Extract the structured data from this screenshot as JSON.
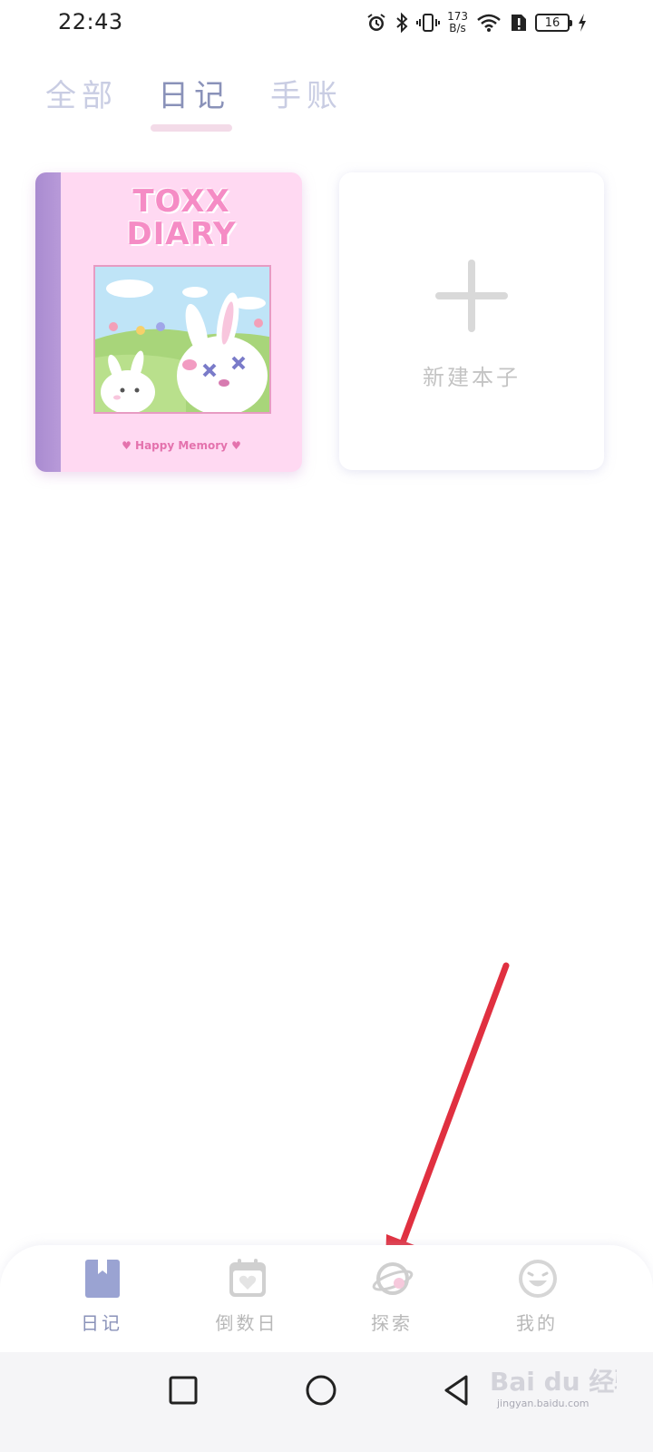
{
  "status_bar": {
    "time": "22:43",
    "net_speed_value": "173",
    "net_speed_unit": "B/s",
    "battery_level": "16",
    "icons": [
      "alarm-icon",
      "bluetooth-icon",
      "vibrate-icon",
      "wifi-icon",
      "sim-alert-icon",
      "battery-icon",
      "charging-icon"
    ]
  },
  "tabs": [
    {
      "label": "全部",
      "active": false
    },
    {
      "label": "日记",
      "active": true
    },
    {
      "label": "手账",
      "active": false
    }
  ],
  "notebook": {
    "title_line1": "TOXX",
    "title_line2": "DIARY",
    "footer": "♥ Happy Memory ♥",
    "cover_color": "#ffd9f2",
    "spine_color": "#a98bd0"
  },
  "new_notebook": {
    "label": "新建本子"
  },
  "bottom_nav": [
    {
      "label": "日记",
      "icon": "bookmark-book-icon",
      "active": true
    },
    {
      "label": "倒数日",
      "icon": "calendar-heart-icon",
      "active": false
    },
    {
      "label": "探索",
      "icon": "planet-icon",
      "active": false
    },
    {
      "label": "我的",
      "icon": "smiley-face-icon",
      "active": false
    }
  ],
  "system_nav": {
    "icons": [
      "recent-apps-icon",
      "home-icon",
      "back-icon"
    ]
  },
  "watermark": {
    "brand": "Bai du 经验",
    "url": "jingyan.baidu.com"
  },
  "colors": {
    "accent": "#8a92b9",
    "tab_inactive": "#c9cde3",
    "tab_underline": "#f3dbe8",
    "annotation_arrow": "#e03040"
  }
}
